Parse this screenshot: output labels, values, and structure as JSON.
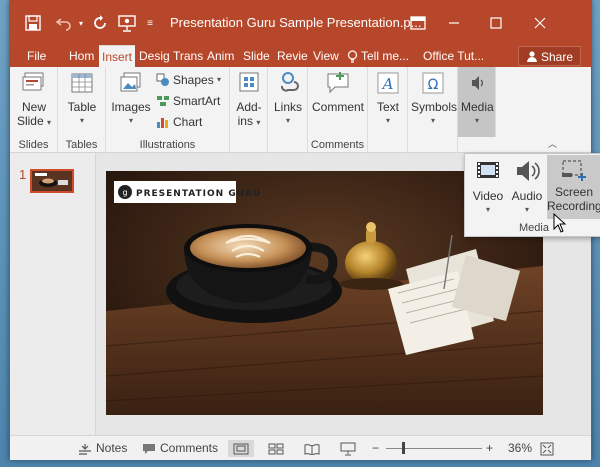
{
  "window": {
    "title": "Presentation Guru Sample Presentation.p...",
    "colors": {
      "accent": "#b7472a",
      "ribbon": "#f3f3f3"
    }
  },
  "tabs": [
    {
      "label": "File"
    },
    {
      "label": "Hom"
    },
    {
      "label": "Insert",
      "active": true
    },
    {
      "label": "Desig"
    },
    {
      "label": "Trans"
    },
    {
      "label": "Anim"
    },
    {
      "label": "Slide"
    },
    {
      "label": "Revie"
    },
    {
      "label": "View"
    },
    {
      "label": "Tell me..."
    },
    {
      "label": "Office Tut..."
    }
  ],
  "share_label": "Share",
  "ribbon": {
    "slides": {
      "new_slide_line1": "New",
      "new_slide_line2": "Slide",
      "group": "Slides"
    },
    "tables": {
      "table": "Table",
      "group": "Tables"
    },
    "illustrations": {
      "images": "Images",
      "shapes": "Shapes",
      "smartart": "SmartArt",
      "chart": "Chart",
      "group": "Illustrations"
    },
    "addins": {
      "line1": "Add-",
      "line2": "ins"
    },
    "links": {
      "label": "Links"
    },
    "comments": {
      "comment": "Comment",
      "group": "Comments"
    },
    "text": {
      "label": "Text"
    },
    "symbols": {
      "label": "Symbols"
    },
    "media": {
      "label": "Media"
    }
  },
  "media_flyout": {
    "video": "Video",
    "audio": "Audio",
    "screen_line1": "Screen",
    "screen_line2": "Recording",
    "group": "Media"
  },
  "slides_pane": {
    "slide_number": "1"
  },
  "slide": {
    "logo_text": "PRESENTATION GURU"
  },
  "status": {
    "notes": "Notes",
    "comments": "Comments",
    "zoom_minus": "−",
    "zoom_plus": "+",
    "zoom": "36%",
    "zoom_fraction": 0.36
  }
}
